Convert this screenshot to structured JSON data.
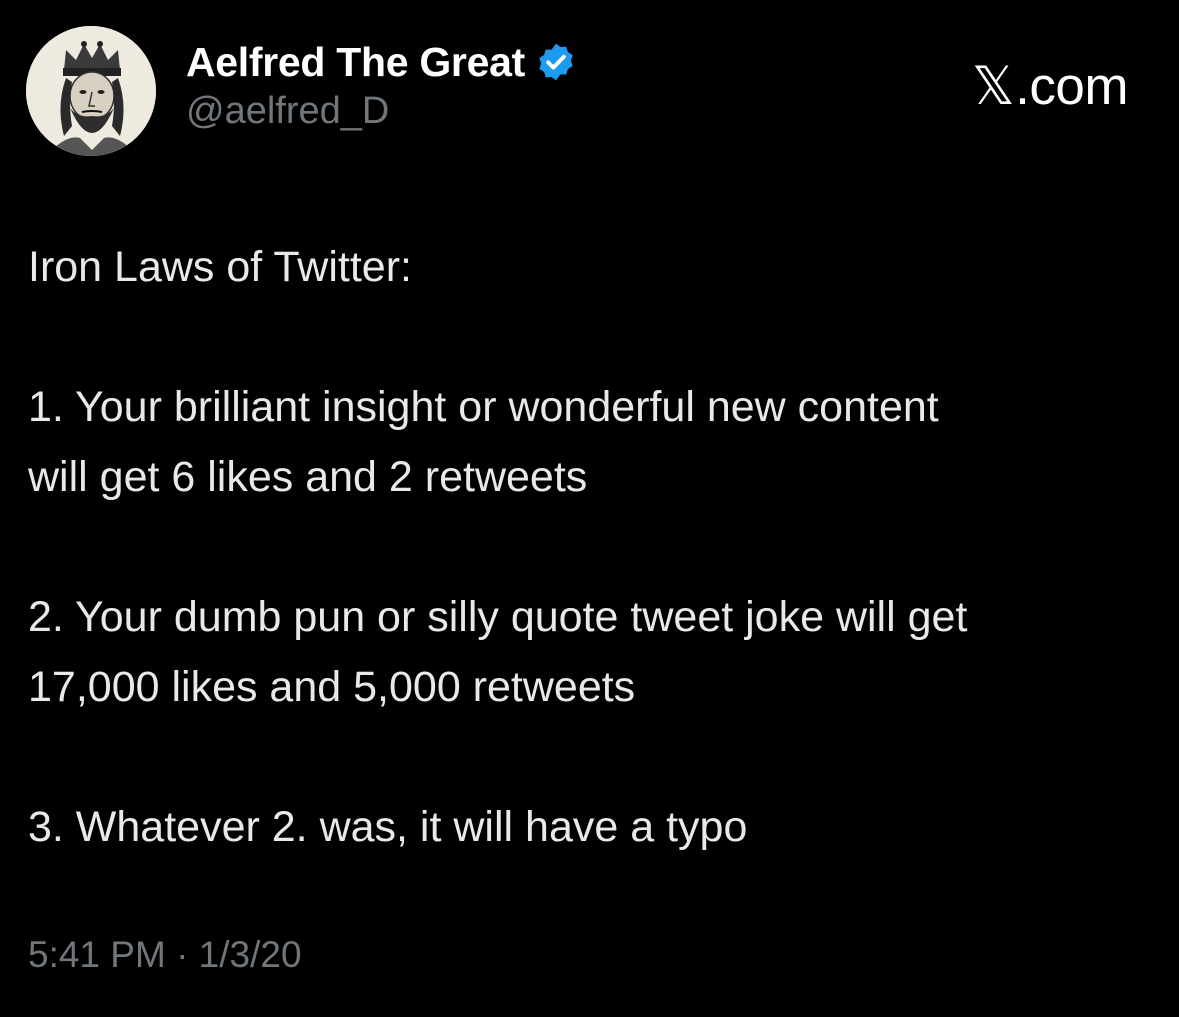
{
  "author": {
    "display_name": "Aelfred The Great",
    "handle": "@aelfred_D",
    "verified": true,
    "avatar_icon": "king-portrait-avatar"
  },
  "brand": {
    "label": ".com",
    "logo_glyph": "𝕏"
  },
  "tweet": {
    "heading": "Iron Laws of Twitter:",
    "law1_line1": "1. Your brilliant insight or wonderful new content",
    "law1_line2": "will get 6 likes and 2 retweets",
    "law2_line1": "2. Your dumb pun or silly quote tweet joke will get",
    "law2_line2": "17,000 likes and 5,000 retweets",
    "law3_line1": "3. Whatever 2. was, it will have a typo"
  },
  "timestamp": "5:41 PM · 1/3/20",
  "colors": {
    "background": "#000000",
    "primary_text": "#e7e9ea",
    "secondary_text": "#71767b",
    "verified_badge": "#1d9bf0"
  }
}
